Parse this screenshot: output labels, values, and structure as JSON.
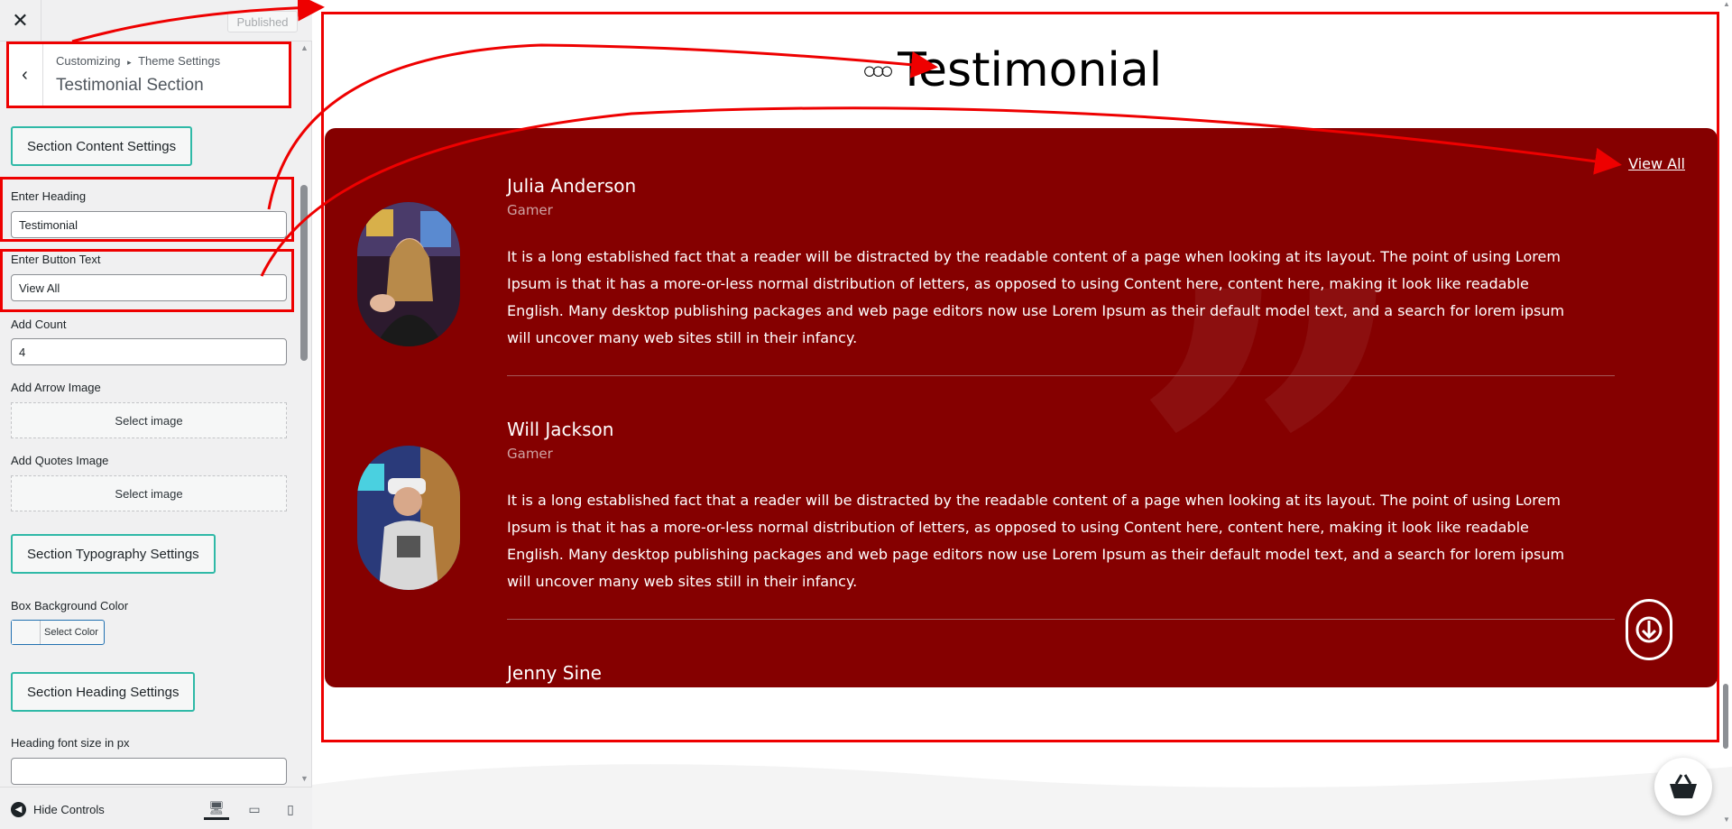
{
  "customizer": {
    "close_icon": "close-icon",
    "published_label": "Published",
    "breadcrumb": {
      "root": "Customizing",
      "separator": "▸",
      "parent": "Theme Settings"
    },
    "section_title": "Testimonial Section",
    "content_settings_label": "Section Content Settings",
    "fields": {
      "heading_label": "Enter Heading",
      "heading_value": "Testimonial",
      "button_label": "Enter Button Text",
      "button_value": "View All",
      "count_label": "Add Count",
      "count_value": "4",
      "arrow_label": "Add Arrow Image",
      "arrow_btn": "Select image",
      "quotes_label": "Add Quotes Image",
      "quotes_btn": "Select image"
    },
    "typography_label": "Section Typography Settings",
    "box_bg_label": "Box Background Color",
    "select_color": "Select Color",
    "heading_settings_label": "Section Heading Settings",
    "font_size_label": "Heading font size in px",
    "font_size_value": "",
    "hide_controls": "Hide Controls"
  },
  "preview": {
    "heading": "Testimonial",
    "view_all": "View All",
    "box_color": "#850000",
    "testimonials": [
      {
        "name": "Julia Anderson",
        "role": "Gamer",
        "text": "It is a long established fact that a reader will be distracted by the readable content of a page when looking at its layout. The point of using Lorem Ipsum is that it has a more-or-less normal distribution of letters, as opposed to using Content here, content here, making it look like readable English. Many desktop publishing packages and web page editors now use Lorem Ipsum as their default model text, and a search for lorem ipsum will uncover many web sites still in their infancy."
      },
      {
        "name": "Will Jackson",
        "role": "Gamer",
        "text": "It is a long established fact that a reader will be distracted by the readable content of a page when looking at its layout. The point of using Lorem Ipsum is that it has a more-or-less normal distribution of letters, as opposed to using Content here, content here, making it look like readable English. Many desktop publishing packages and web page editors now use Lorem Ipsum as their default model text, and a search for lorem ipsum will uncover many web sites still in their infancy."
      },
      {
        "name": "Jenny Sine"
      }
    ]
  }
}
